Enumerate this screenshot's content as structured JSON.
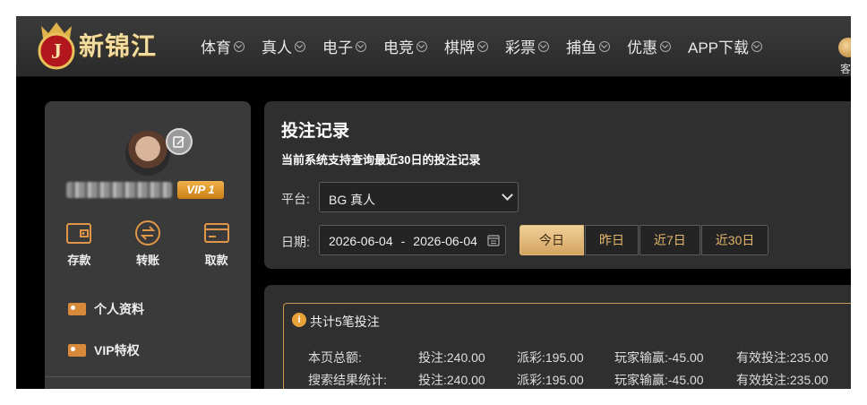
{
  "brand": {
    "name": "新锦江",
    "logo_letter": "J"
  },
  "nav": {
    "items": [
      {
        "label": "体育"
      },
      {
        "label": "真人"
      },
      {
        "label": "电子"
      },
      {
        "label": "电竞"
      },
      {
        "label": "棋牌"
      },
      {
        "label": "彩票"
      },
      {
        "label": "捕鱼"
      },
      {
        "label": "优惠"
      },
      {
        "label": "APP下载"
      }
    ],
    "service_label": "客"
  },
  "sidebar": {
    "vip": "VIP 1",
    "actions": [
      {
        "label": "存款",
        "icon": "wallet-icon"
      },
      {
        "label": "转账",
        "icon": "transfer-icon"
      },
      {
        "label": "取款",
        "icon": "card-icon"
      }
    ],
    "menu": [
      {
        "label": "个人资料",
        "icon": "id-card-icon"
      },
      {
        "label": "VIP特权",
        "icon": "vip-card-icon"
      }
    ]
  },
  "records": {
    "title": "投注记录",
    "subtitle": "当前系统支持查询最近30日的投注记录",
    "platform_label": "平台:",
    "platform_value": "BG 真人",
    "date_label": "日期:",
    "date_start": "2026-06-04",
    "date_sep": "-",
    "date_end": "2026-06-04",
    "quick_ranges": [
      {
        "label": "今日",
        "active": true
      },
      {
        "label": "昨日",
        "active": false
      },
      {
        "label": "近7日",
        "active": false
      },
      {
        "label": "近30日",
        "active": false
      }
    ]
  },
  "summary": {
    "notice": "共计5笔投注",
    "rows": [
      {
        "label": "本页总额:",
        "bet": "投注:240.00",
        "payout": "派彩:195.00",
        "winloss": "玩家输赢:-45.00",
        "valid": "有效投注:235.00"
      },
      {
        "label": "搜索结果统计:",
        "bet": "投注:240.00",
        "payout": "派彩:195.00",
        "winloss": "玩家输赢:-45.00",
        "valid": "有效投注:235.00"
      }
    ]
  },
  "colors": {
    "accent": "#d4a461",
    "badge": "#e8a23a",
    "panel": "#2f2f2f"
  }
}
